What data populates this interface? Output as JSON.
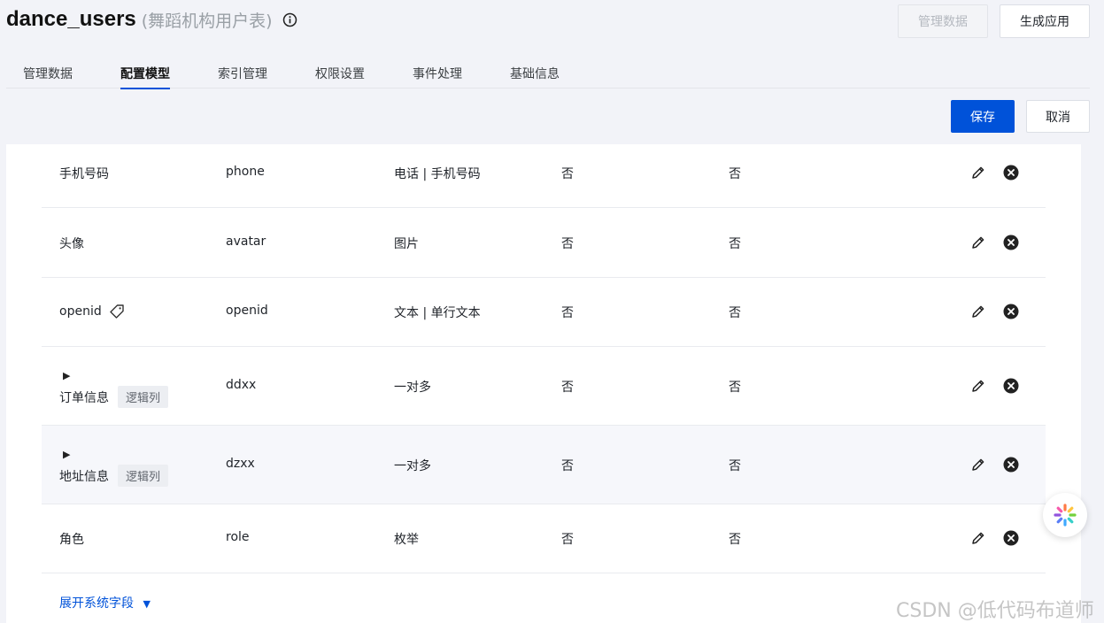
{
  "header": {
    "title": "dance_users",
    "subtitle": "(舞蹈机构用户表)",
    "manage_data_btn": "管理数据",
    "generate_app_btn": "生成应用"
  },
  "tabs": [
    {
      "label": "管理数据"
    },
    {
      "label": "配置模型",
      "active": true
    },
    {
      "label": "索引管理"
    },
    {
      "label": "权限设置"
    },
    {
      "label": "事件处理"
    },
    {
      "label": "基础信息"
    }
  ],
  "toolbar": {
    "save_label": "保存",
    "cancel_label": "取消"
  },
  "rows": [
    {
      "name": "手机号码",
      "field": "phone",
      "type": "电话 | 手机号码",
      "col4": "否",
      "col5": "否"
    },
    {
      "name": "头像",
      "field": "avatar",
      "type": "图片",
      "col4": "否",
      "col5": "否"
    },
    {
      "name": "openid",
      "field": "openid",
      "type": "文本 | 单行文本",
      "col4": "否",
      "col5": "否"
    },
    {
      "name": "订单信息",
      "tag": "逻辑列",
      "field": "ddxx",
      "type": "一对多",
      "col4": "否",
      "col5": "否"
    },
    {
      "name": "地址信息",
      "tag": "逻辑列",
      "field": "dzxx",
      "type": "一对多",
      "col4": "否",
      "col5": "否"
    },
    {
      "name": "角色",
      "field": "role",
      "type": "枚举",
      "col4": "否",
      "col5": "否"
    }
  ],
  "expand_label": "展开系统字段",
  "watermark": "CSDN @低代码布道师",
  "colors": {
    "primary": "#0052d9",
    "background": "#f2f3f8"
  }
}
